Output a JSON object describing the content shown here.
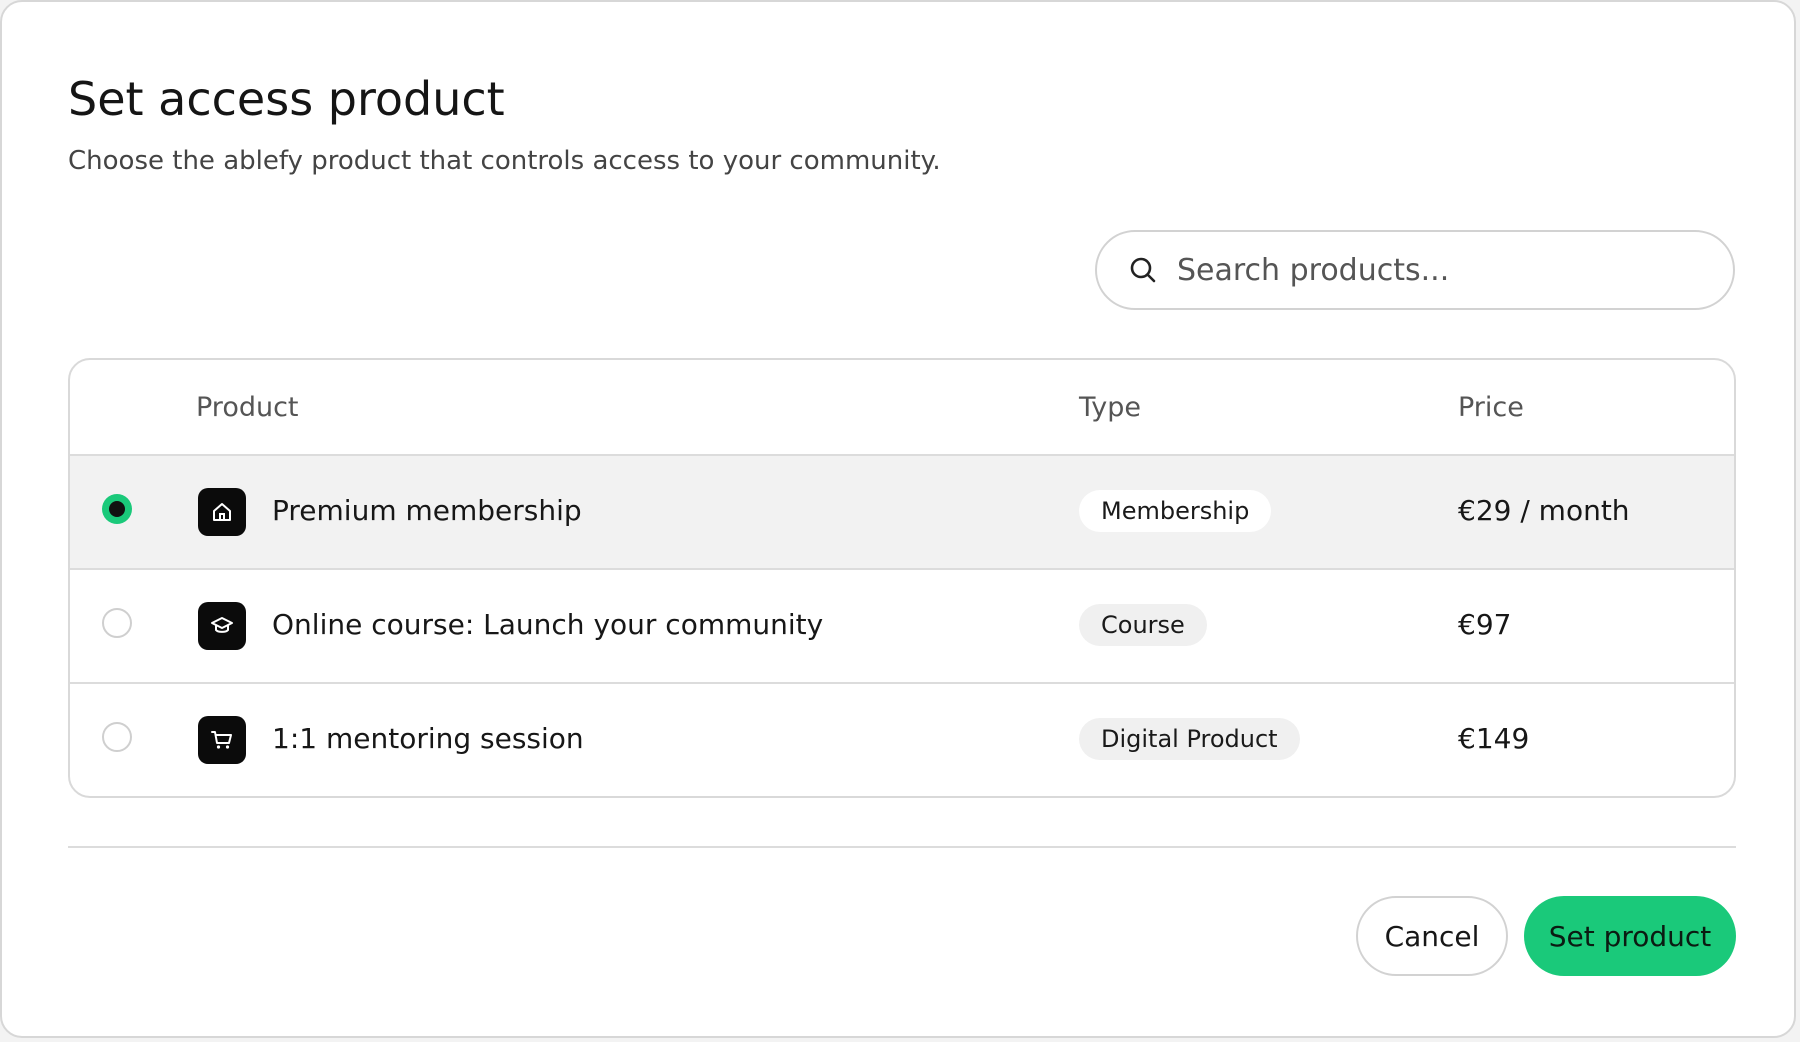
{
  "dialog": {
    "title": "Set access product",
    "subtitle": "Choose the ablefy product that controls access to your community."
  },
  "search": {
    "placeholder": "Search products...",
    "value": "",
    "icon": "search-icon"
  },
  "table": {
    "headers": {
      "product": "Product",
      "type": "Type",
      "price": "Price"
    },
    "rows": [
      {
        "name": "Premium membership",
        "type": "Membership",
        "price": "€29 / month",
        "icon": "home-icon",
        "selected": true
      },
      {
        "name": "Online course: Launch your community",
        "type": "Course",
        "price": "€97",
        "icon": "graduation-cap-icon",
        "selected": false
      },
      {
        "name": "1:1 mentoring session",
        "type": "Digital Product",
        "price": "€149",
        "icon": "shopping-cart-icon",
        "selected": false
      }
    ]
  },
  "actions": {
    "cancel_label": "Cancel",
    "confirm_label": "Set product"
  },
  "colors": {
    "accent": "#1ac97a",
    "selected_row": "#f2f2f2"
  }
}
